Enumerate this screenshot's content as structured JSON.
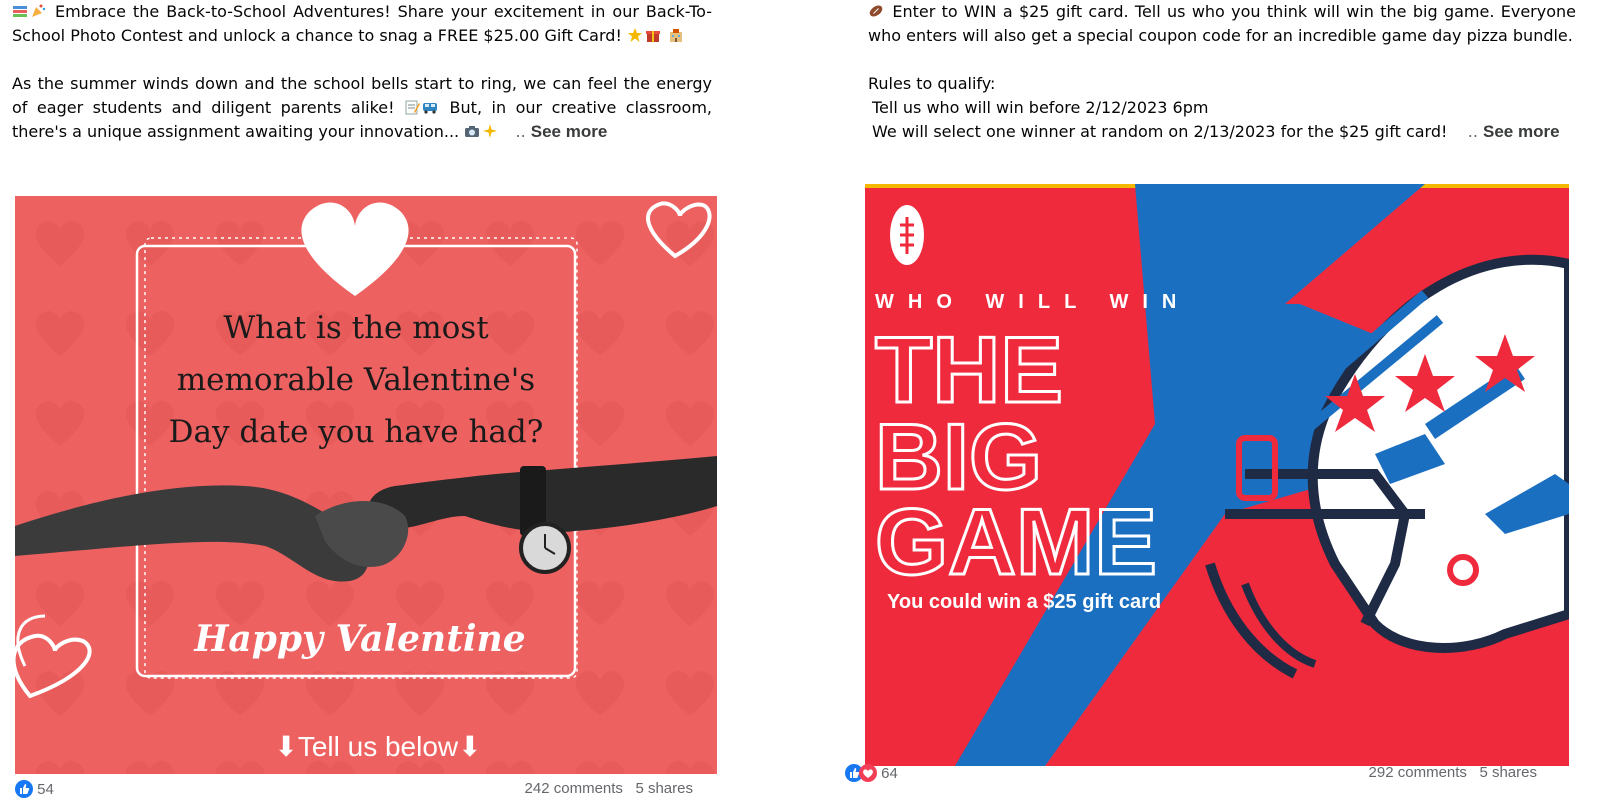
{
  "left_post": {
    "intro_text": "Embrace the Back-to-School Adventures! Share your excitement in our Back-To-School Photo Contest and unlock a chance to snag a FREE $25.00 Gift Card!",
    "body_text_1": "As the summer winds down and the school bells start to ring, we can feel the energy of eager students and diligent parents alike!",
    "body_text_2": "But, in our creative classroom, there's a unique assignment awaiting your innovation...",
    "ellipsis": "..",
    "see_more": "See more",
    "image": {
      "question": "What is the most memorable Valentine's Day date you have had?",
      "script": "Happy Valentine",
      "cta": "⬇Tell us below⬇",
      "colors": {
        "background": "#ee6161",
        "dark_bg": "#d94b4b"
      }
    },
    "reactions_count": "54",
    "comments": "242 comments",
    "shares": "5 shares"
  },
  "right_post": {
    "line1": "Enter to WIN a $25 gift card. Tell us who you think will win the big game. Everyone who enters will also get a special coupon code for an incredible game day pizza bundle.",
    "rules_title": "Rules to qualify:",
    "rule_1": "Tell us who will win before 2/12/2023 6pm",
    "rule_2": "We will select one winner at random on 2/13/2023 for the $25 gift card!",
    "ellipsis": "..",
    "see_more": "See more",
    "image": {
      "kicker": "WHO WILL WIN",
      "title_1": "THE",
      "title_2": "BIG",
      "title_3": "GAME",
      "subtitle": "You could win a $25 gift card",
      "colors": {
        "red": "#ef2a3d",
        "blue": "#1a6fc1",
        "navy": "#1f2a44"
      }
    },
    "reactions_count": "64",
    "comments": "292 comments",
    "shares": "5 shares"
  },
  "icons": [
    "books-icon",
    "party-icon",
    "star-icon",
    "gift-icon",
    "school-icon",
    "memo-icon",
    "bus-icon",
    "camera-icon",
    "sparkles-icon",
    "football-icon",
    "like-icon",
    "love-icon"
  ]
}
